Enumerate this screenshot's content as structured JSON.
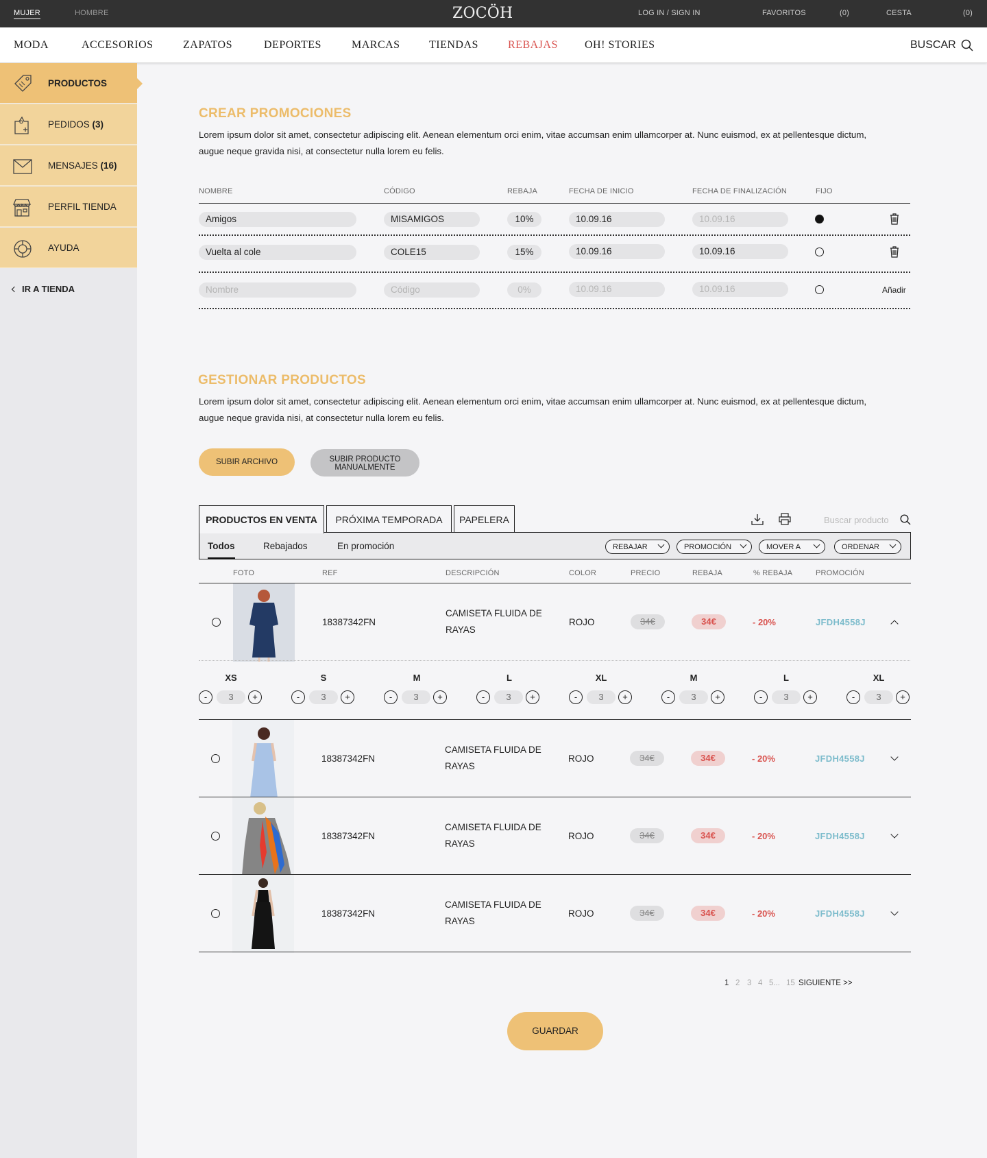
{
  "topbar": {
    "gender_women": "MUJER",
    "gender_men": "HOMBRE",
    "logo": "ZOCÖH",
    "login": "LOG IN / SIGN IN",
    "favorites": "FAVORITOS",
    "favorites_count": "(0)",
    "cart": "CESTA",
    "cart_count": "(0)"
  },
  "nav": {
    "items": [
      "MODA",
      "ACCESORIOS",
      "ZAPATOS",
      "DEPORTES",
      "MARCAS",
      "TIENDAS",
      "REBAJAS",
      "OH! STORIES"
    ],
    "search": "BUSCAR"
  },
  "sidebar": {
    "items": [
      {
        "label": "PRODUCTOS",
        "count": ""
      },
      {
        "label": "PEDIDOS",
        "count": "(3)"
      },
      {
        "label": "MENSAJES",
        "count": "(16)"
      },
      {
        "label": "PERFIL TIENDA",
        "count": ""
      },
      {
        "label": "AYUDA",
        "count": ""
      }
    ],
    "go_store": "IR A TIENDA"
  },
  "promotions": {
    "title": "CREAR PROMOCIONES",
    "text": "Lorem ipsum dolor sit amet, consectetur adipiscing elit. Aenean elementum orci enim, vitae accumsan enim ullamcorper at. Nunc euismod, ex at pellentesque dictum, augue neque gravida nisi, at consectetur nulla lorem eu felis.",
    "headers": [
      "NOMBRE",
      "CÓDIGO",
      "REBAJA",
      "FECHA DE INICIO",
      "FECHA DE FINALIZACIÓN",
      "FIJO"
    ],
    "rows": [
      {
        "name": "Amigos",
        "code": "MISAMIGOS",
        "discount": "10%",
        "start": "10.09.16",
        "end": "10.09.16",
        "fixed": true
      },
      {
        "name": "Vuelta al cole",
        "code": "COLE15",
        "discount": "15%",
        "start": "10.09.16",
        "end": "10.09.16",
        "fixed": false
      }
    ],
    "new_row": {
      "name_ph": "Nombre",
      "code_ph": "Código",
      "discount_ph": "0%",
      "start_ph": "10.09.16",
      "end_ph": "10.09.16",
      "add_label": "Añadir"
    }
  },
  "products": {
    "title": "GESTIONAR PRODUCTOS",
    "text": "Lorem ipsum dolor sit amet, consectetur adipiscing elit. Aenean elementum orci enim, vitae accumsan enim ullamcorper at. Nunc euismod, ex at pellentesque dictum, augue neque gravida nisi, at consectetur nulla lorem eu felis.",
    "upload_file": "SUBIR ARCHIVO",
    "upload_manual": "SUBIR PRODUCTO MANUALMENTE",
    "tabs": [
      "PRODUCTOS EN VENTA",
      "PRÓXIMA TEMPORADA",
      "PAPELERA"
    ],
    "search_placeholder": "Buscar producto",
    "subtabs": [
      "Todos",
      "Rebajados",
      "En promoción"
    ],
    "dropdowns": [
      "REBAJAR",
      "PROMOCIÓN",
      "MOVER A",
      "ORDENAR"
    ],
    "headers": [
      "FOTO",
      "REF",
      "DESCRIPCIÓN",
      "COLOR",
      "PRECIO",
      "REBAJA",
      "% REBAJA",
      "PROMOCIÓN"
    ],
    "rows": [
      {
        "ref": "18387342FN",
        "desc1": "CAMISETA FLUIDA DE",
        "desc2": "RAYAS",
        "color": "ROJO",
        "price": "34€",
        "sale": "34€",
        "pct": "- 20%",
        "promo": "JFDH4558J"
      },
      {
        "ref": "18387342FN",
        "desc1": "CAMISETA FLUIDA DE",
        "desc2": "RAYAS",
        "color": "ROJO",
        "price": "34€",
        "sale": "34€",
        "pct": "- 20%",
        "promo": "JFDH4558J"
      },
      {
        "ref": "18387342FN",
        "desc1": "CAMISETA FLUIDA DE",
        "desc2": "RAYAS",
        "color": "ROJO",
        "price": "34€",
        "sale": "34€",
        "pct": "- 20%",
        "promo": "JFDH4558J"
      },
      {
        "ref": "18387342FN",
        "desc1": "CAMISETA FLUIDA DE",
        "desc2": "RAYAS",
        "color": "ROJO",
        "price": "34€",
        "sale": "34€",
        "pct": "- 20%",
        "promo": "JFDH4558J"
      }
    ],
    "sizes": [
      {
        "label": "XS",
        "qty": "3"
      },
      {
        "label": "S",
        "qty": "3"
      },
      {
        "label": "M",
        "qty": "3"
      },
      {
        "label": "L",
        "qty": "3"
      },
      {
        "label": "XL",
        "qty": "3"
      },
      {
        "label": "M",
        "qty": "3"
      },
      {
        "label": "L",
        "qty": "3"
      },
      {
        "label": "XL",
        "qty": "3"
      }
    ],
    "stepper_minus": "-",
    "stepper_plus": "+",
    "pagination": [
      "1",
      "2",
      "3",
      "4",
      "5...",
      "15"
    ],
    "next": "SIGUIENTE >>",
    "save": "GUARDAR"
  },
  "colors": {
    "accent": "#ecbc6a",
    "sale": "#d9534f",
    "promo": "#7dbccc",
    "sidebar_item": "#f2d49b",
    "topbar": "#323232"
  }
}
